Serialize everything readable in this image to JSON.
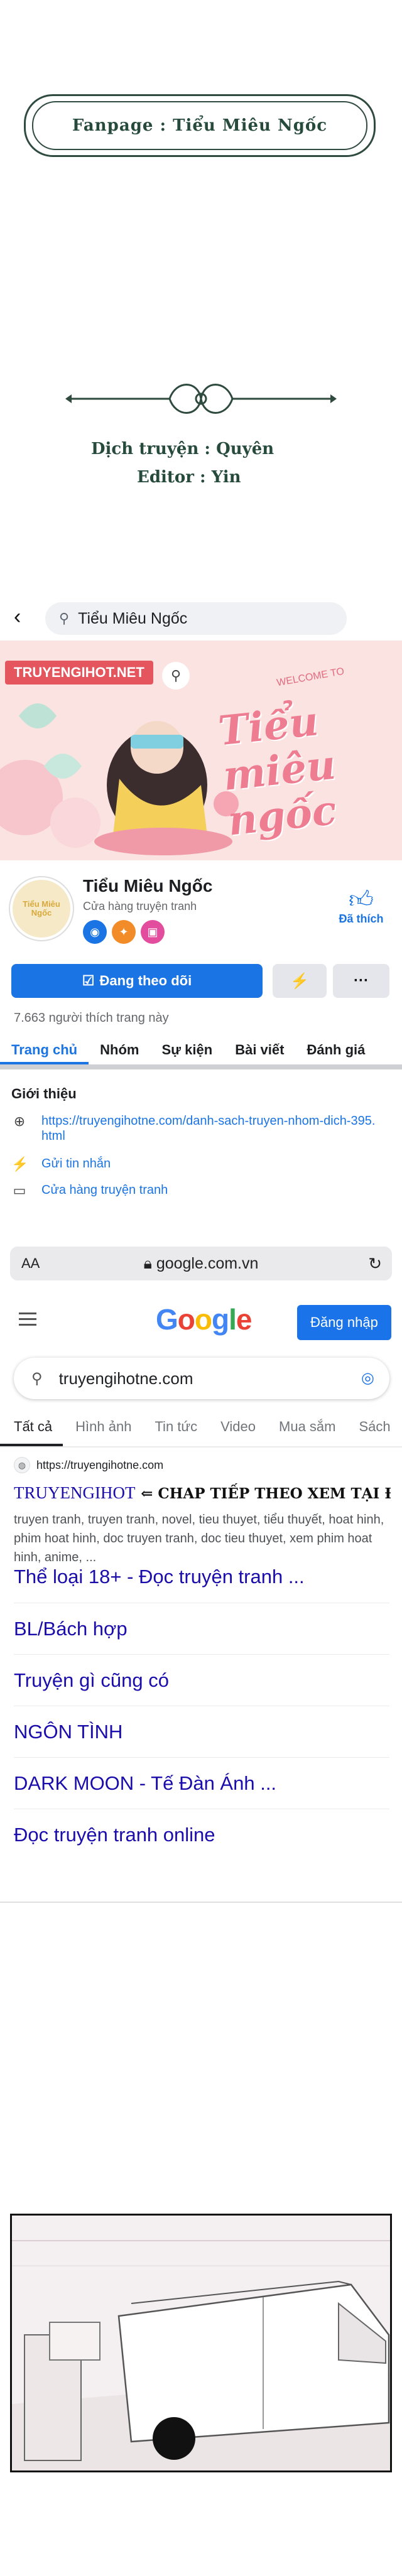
{
  "credits": {
    "fanpage": "Fanpage : Tiểu Miêu Ngốc",
    "translator": "Dịch truyện : Quyên",
    "editor": "Editor : Yin"
  },
  "facebook": {
    "search_query": "Tiểu Miêu Ngốc",
    "cover": {
      "logo": "TRUYENGIHOT.NET",
      "welcome": "WELCOME TO",
      "title": "Tiểu miêu ngốc"
    },
    "page_name": "Tiểu Miêu Ngốc",
    "page_category": "Cửa hàng truyện tranh",
    "avatar_text": "Tiểu Miêu Ngốc",
    "like_label": "Đã thích",
    "follow_label": "Đang theo dõi",
    "likes_count": "7.663 người thích trang này",
    "tabs": [
      "Trang chủ",
      "Nhóm",
      "Sự kiện",
      "Bài viết",
      "Đánh giá"
    ],
    "intro_title": "Giới thiệu",
    "intro_link": "https://truyengihotne.com/danh-sach-truyen-nhom-dich-395.html",
    "send_message": "Gửi tin nhắn",
    "category_link": "Cửa hàng truyện tranh"
  },
  "browser": {
    "aa": "AA",
    "url": "google.com.vn"
  },
  "google": {
    "logo_letters": [
      {
        "ch": "G",
        "color": "#4285f4"
      },
      {
        "ch": "o",
        "color": "#ea4335"
      },
      {
        "ch": "o",
        "color": "#fbbc05"
      },
      {
        "ch": "g",
        "color": "#4285f4"
      },
      {
        "ch": "l",
        "color": "#34a853"
      },
      {
        "ch": "e",
        "color": "#ea4335"
      }
    ],
    "signin": "Đăng nhập",
    "query": "truyengihotne.com",
    "tabs": [
      "Tất cả",
      "Hình ảnh",
      "Tin tức",
      "Video",
      "Mua sắm",
      "Sách"
    ],
    "result": {
      "site": "https://truyengihotne.com",
      "title_main": "TRUYENGIHOT",
      "title_note": "⇐ CHAP TIẾP THEO XEM TẠI ĐÂY NHA",
      "snippet": "truyen tranh, truyen tranh, novel, tieu thuyet, tiểu thuyết, hoat hinh, phim hoat hinh, doc truyen tranh, doc tieu thuyet, xem phim hoat hinh, anime, ..."
    },
    "sitelinks": [
      "Thể loại 18+ - Đọc truyện tranh ...",
      "BL/Bách hợp",
      "Truyện gì cũng có",
      "NGÔN TÌNH",
      "DARK MOON - Tế Đàn Ánh ...",
      "Đọc truyện tranh online"
    ]
  },
  "colors": {
    "fb_blue": "#1b74e4",
    "google_link": "#1a0dab",
    "credits_green": "#264a3c"
  }
}
